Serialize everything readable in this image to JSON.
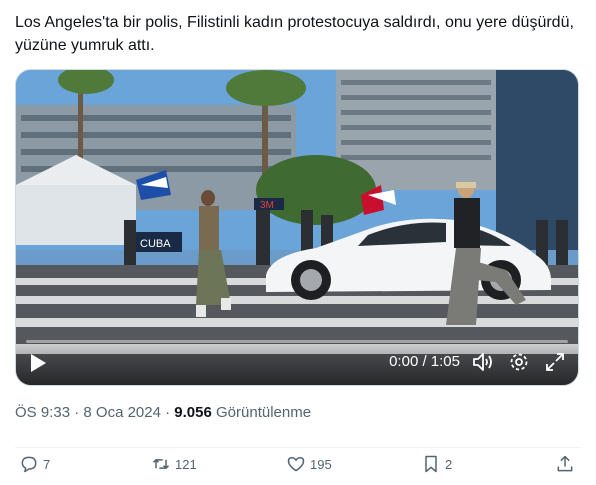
{
  "tweet": {
    "text": "Los Angeles'ta bir polis, Filistinli kadın protestocuya saldırdı, onu yere düşürdü, yüzüne yumruk attı."
  },
  "video": {
    "time_display": "0:00 / 1:05",
    "play_icon": "play-icon",
    "volume_icon": "volume-icon",
    "settings_icon": "settings-icon",
    "fullscreen_icon": "fullscreen-icon",
    "scene_text": {
      "banner": "CUBA",
      "sign": "3M"
    }
  },
  "meta": {
    "time": "ÖS 9:33",
    "separator": "·",
    "date": "8 Oca 2024",
    "views_count": "9.056",
    "views_label": "Görüntülenme"
  },
  "actions": {
    "replies": "7",
    "reposts": "121",
    "likes": "195",
    "bookmarks": "2"
  }
}
